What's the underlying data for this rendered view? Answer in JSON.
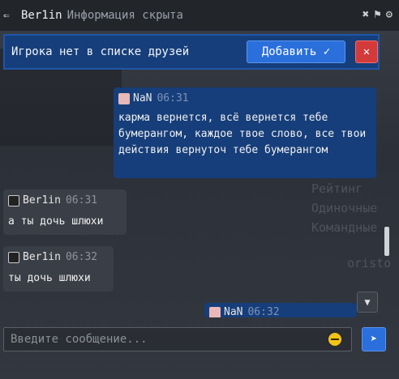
{
  "header": {
    "back_icon": "arrow-left-icon",
    "username": "Ber1in",
    "status": "Информация скрыта"
  },
  "banner": {
    "text": "Игрока нет в списке друзей",
    "add_label": "Добавить ✓",
    "close_label": "✕"
  },
  "background_text": [
    "Рейтинг",
    "Одиночные",
    "Командные",
    "oristo"
  ],
  "messages": [
    {
      "author": "NaN",
      "time": "06:31",
      "text": "карма вернется, всё вернется тебе бумерангом, каждое твое слово, все твои действия вернуточ тебе бумерангом",
      "side": "me"
    },
    {
      "author": "Ber1in",
      "time": "06:31",
      "text": "а ты дочь шлюхи",
      "side": "them"
    },
    {
      "author": "Ber1in",
      "time": "06:32",
      "text": "ты дочь шлюхи",
      "side": "them"
    },
    {
      "author": "NaN",
      "time": "06:32",
      "text": "",
      "side": "me"
    }
  ],
  "input": {
    "placeholder": "Введите сообщение..."
  },
  "colors": {
    "accent": "#2a6fdb",
    "own_bubble": "#163e7a",
    "other_bubble": "#3a3e46",
    "danger": "#d33a3a"
  }
}
